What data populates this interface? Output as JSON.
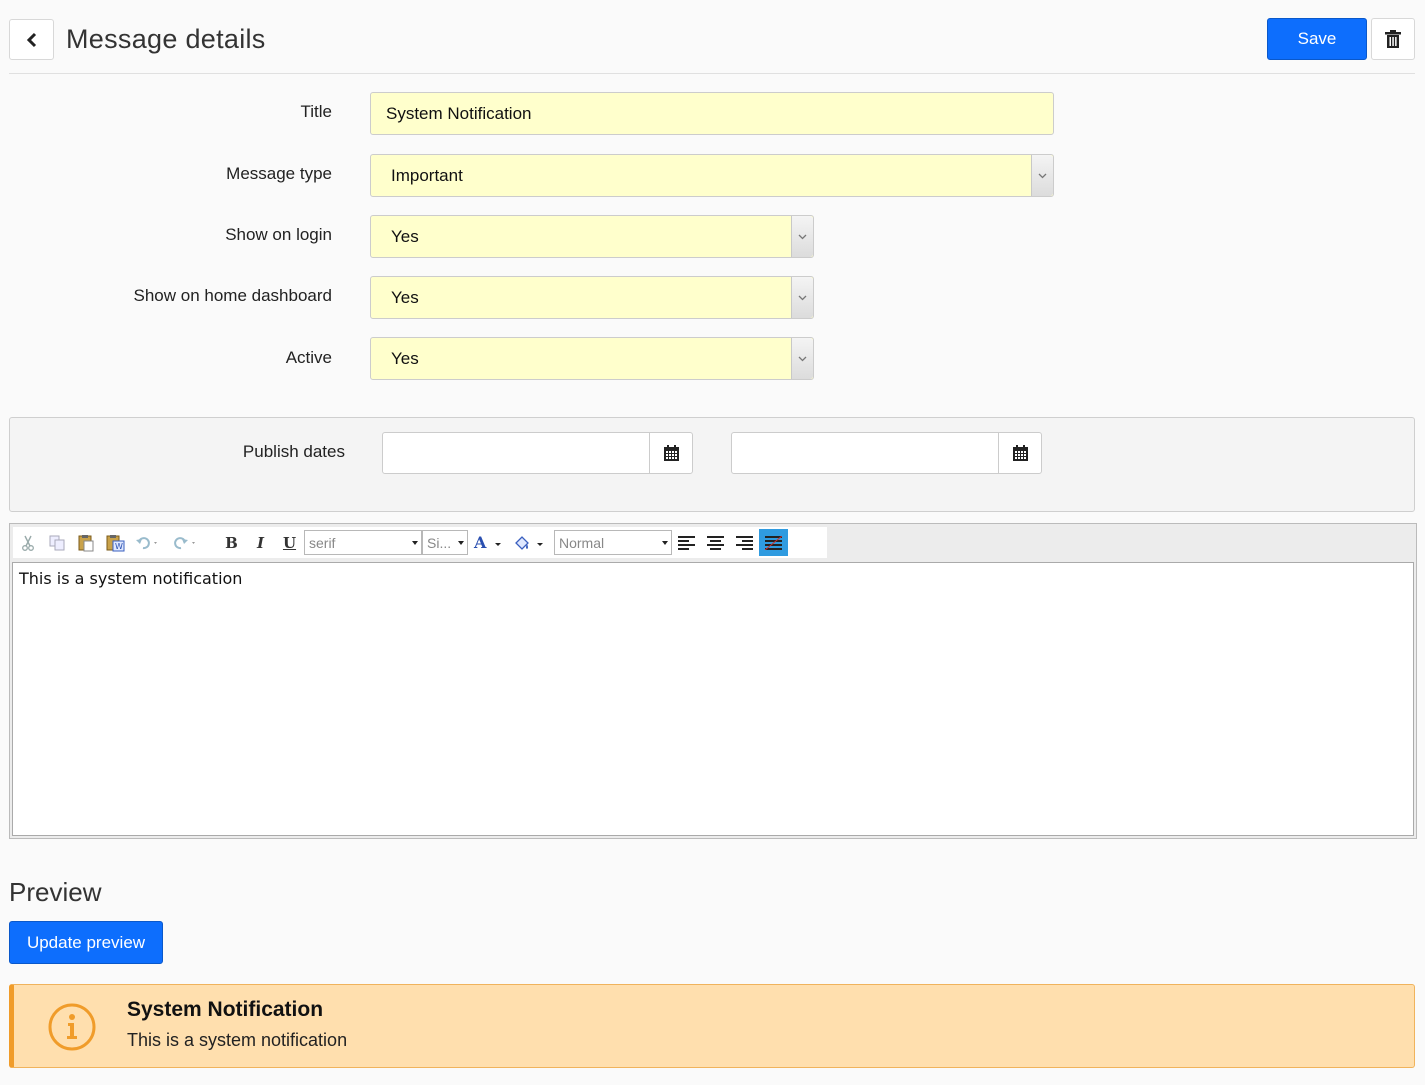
{
  "header": {
    "title": "Message details",
    "save_label": "Save"
  },
  "form": {
    "title_label": "Title",
    "title_value": "System Notification",
    "message_type_label": "Message type",
    "message_type_value": "Important",
    "show_on_login_label": "Show on login",
    "show_on_login_value": "Yes",
    "show_on_home_dashboard_label": "Show on home dashboard",
    "show_on_home_dashboard_value": "Yes",
    "active_label": "Active",
    "active_value": "Yes"
  },
  "publish": {
    "label": "Publish dates",
    "start_value": "",
    "end_value": ""
  },
  "editor": {
    "font_value": "serif",
    "size_value": "Si...",
    "format_value": "Normal",
    "content": "This is a system notification"
  },
  "preview": {
    "heading": "Preview",
    "update_label": "Update preview",
    "notification_title": "System Notification",
    "notification_text": "This is a system notification",
    "accent_color": "#f09c2a",
    "background_color": "#ffdfae"
  },
  "colors": {
    "primary": "#0d6efd",
    "field_background": "#ffffcc"
  }
}
